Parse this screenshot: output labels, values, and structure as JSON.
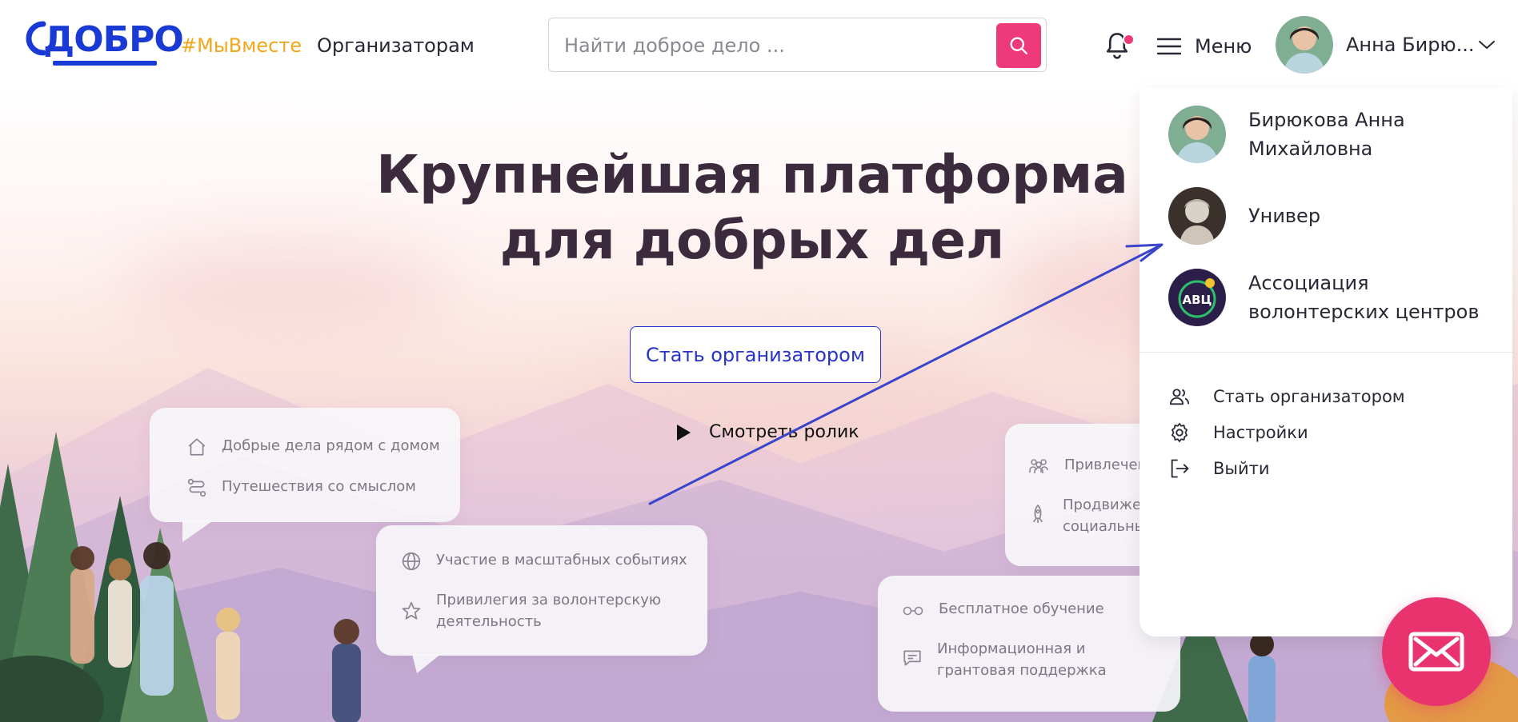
{
  "header": {
    "logo_text": "ДОБРО",
    "hashtag": "#МыВместе",
    "organizers_link": "Организаторам",
    "search_placeholder": "Найти доброе дело ...",
    "menu_label": "Меню",
    "user_name": "Анна Бирю...",
    "accent_color": "#ee3a7a",
    "brand_color": "#1a3ad6"
  },
  "hero": {
    "title_line1": "Крупнейшая платформа",
    "title_line2": "для добрых дел",
    "cta_label": "Стать организатором",
    "video_label": "Смотреть ролик"
  },
  "cards": {
    "card1": {
      "item1": "Добрые дела рядом с домом",
      "item2": "Путешествия со смыслом"
    },
    "card2": {
      "item1": "Участие в масштабных событиях",
      "item2": "Привилегия за волонтерскую деятельность"
    },
    "card3": {
      "item1": "Привлечен",
      "item2": "Продвиже социальны"
    },
    "card4": {
      "item1": "Бесплатное обучение",
      "item2": "Информационная и грантовая поддержка"
    }
  },
  "dropdown": {
    "profiles": [
      {
        "name": "Бирюкова Анна Михайловна"
      },
      {
        "name": "Универ"
      },
      {
        "name": "Ассоциация волонтерских центров",
        "badge": "АВЦ"
      }
    ],
    "actions": [
      {
        "label": "Стать организатором",
        "icon": "users-icon"
      },
      {
        "label": "Настройки",
        "icon": "gear-icon"
      },
      {
        "label": "Выйти",
        "icon": "logout-icon"
      }
    ]
  }
}
